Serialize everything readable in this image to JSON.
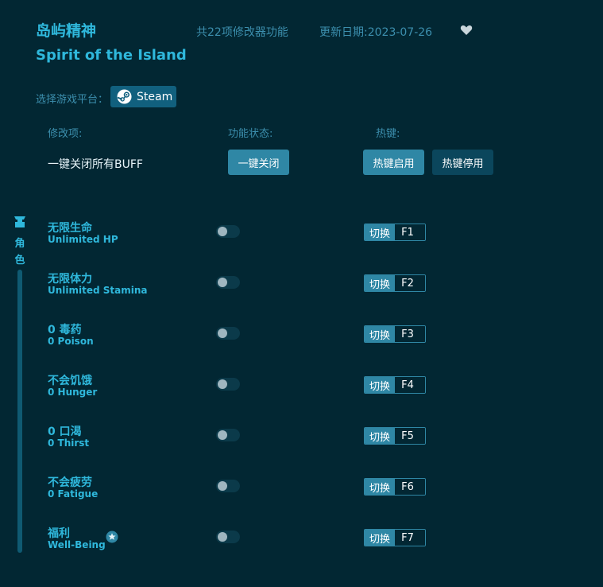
{
  "header": {
    "title_cn": "岛屿精神",
    "title_en": "Spirit of the Island",
    "feature_count": "共22项修改器功能",
    "update_date": "更新日期:2023-07-26"
  },
  "platform": {
    "label": "选择游戏平台：",
    "steam_label": "Steam"
  },
  "columns": {
    "modifier": "修改项:",
    "status": "功能状态:",
    "hotkey": "热键:"
  },
  "global": {
    "close_all_label": "一键关闭所有BUFF",
    "close_button": "一键关闭",
    "hotkey_enable": "热键启用",
    "hotkey_disable": "热键停用"
  },
  "sidebar": {
    "category": "角色"
  },
  "cheats": [
    {
      "cn": "无限生命",
      "en": "Unlimited HP",
      "toggle_label": "切换",
      "key": "F1"
    },
    {
      "cn": "无限体力",
      "en": "Unlimited Stamina",
      "toggle_label": "切换",
      "key": "F2"
    },
    {
      "cn": "0 毒药",
      "en": "0 Poison",
      "toggle_label": "切换",
      "key": "F3"
    },
    {
      "cn": "不会饥饿",
      "en": "0 Hunger",
      "toggle_label": "切换",
      "key": "F4"
    },
    {
      "cn": "0 口渴",
      "en": "0 Thirst",
      "toggle_label": "切换",
      "key": "F5"
    },
    {
      "cn": "不会疲劳",
      "en": "0 Fatigue",
      "toggle_label": "切换",
      "key": "F6"
    },
    {
      "cn": "福利",
      "en": "Well-Being",
      "toggle_label": "切换",
      "key": "F7"
    }
  ]
}
